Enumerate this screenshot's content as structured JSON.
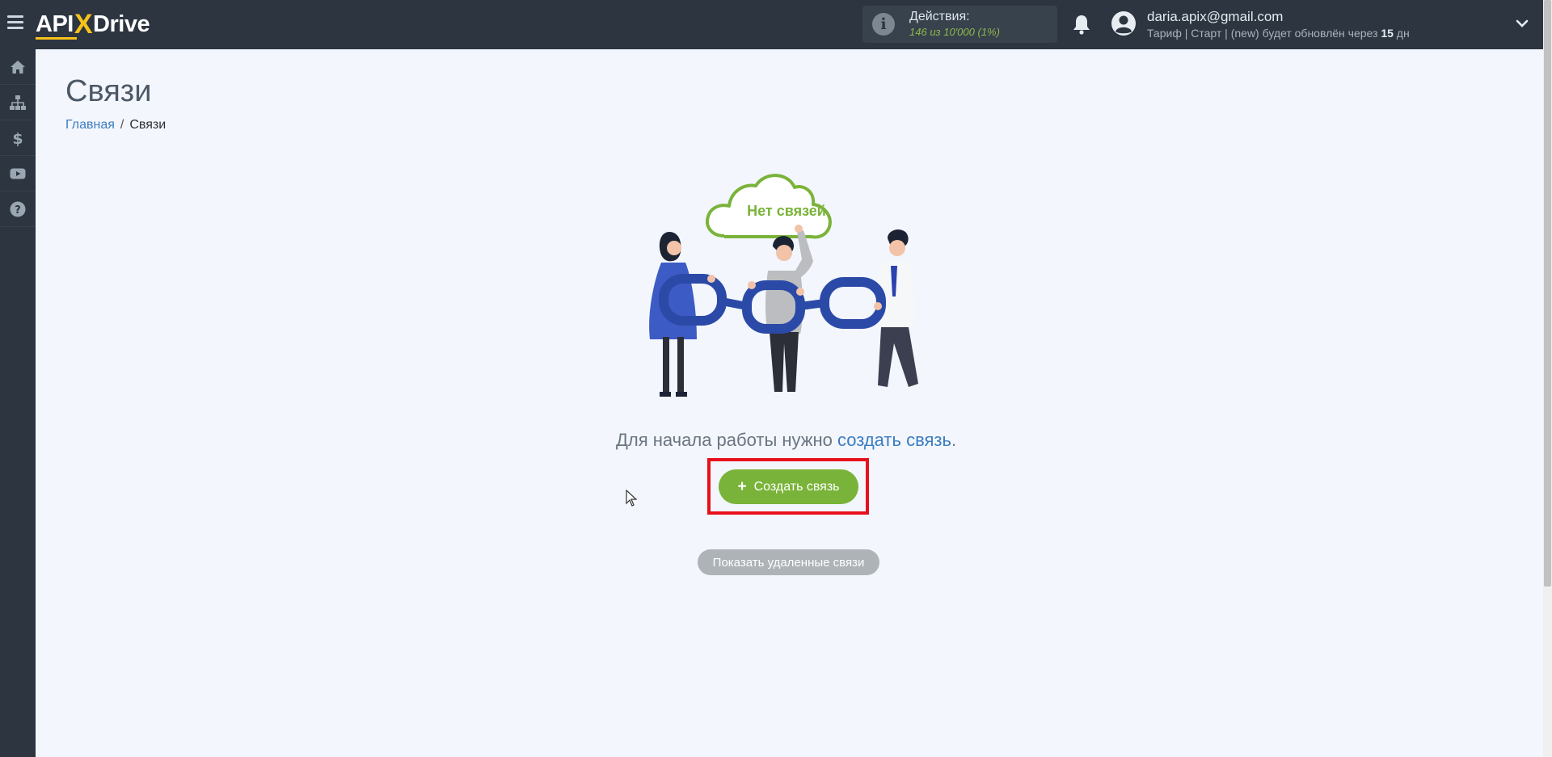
{
  "header": {
    "logo_api": "API",
    "logo_x": "X",
    "logo_drive": "Drive",
    "actions_title": "Действия:",
    "actions_used": "146",
    "actions_of": "из",
    "actions_total": "10'000",
    "actions_percent": "(1%)",
    "user_email": "daria.apix@gmail.com",
    "plan_prefix": "Тариф | Старт | (new) будет обновлён через",
    "plan_days": "15",
    "plan_suffix": "дн"
  },
  "sidebar": {
    "items": [
      {
        "icon": "home-icon"
      },
      {
        "icon": "sitemap-icon"
      },
      {
        "icon": "dollar-icon"
      },
      {
        "icon": "youtube-icon"
      },
      {
        "icon": "help-icon"
      }
    ]
  },
  "main": {
    "title": "Связи",
    "breadcrumb_home": "Главная",
    "breadcrumb_sep": "/",
    "breadcrumb_current": "Связи",
    "cloud_text": "Нет связей",
    "empty_text": "Для начала работы нужно",
    "empty_link": "создать связь",
    "empty_end": ".",
    "create_plus": "+",
    "create_label": "Создать связь",
    "show_deleted_label": "Показать удаленные связи"
  },
  "colors": {
    "topbar": "#2c3540",
    "accent_green": "#7ab339",
    "link_blue": "#3a7dc0",
    "highlight_red": "#e8101c"
  }
}
